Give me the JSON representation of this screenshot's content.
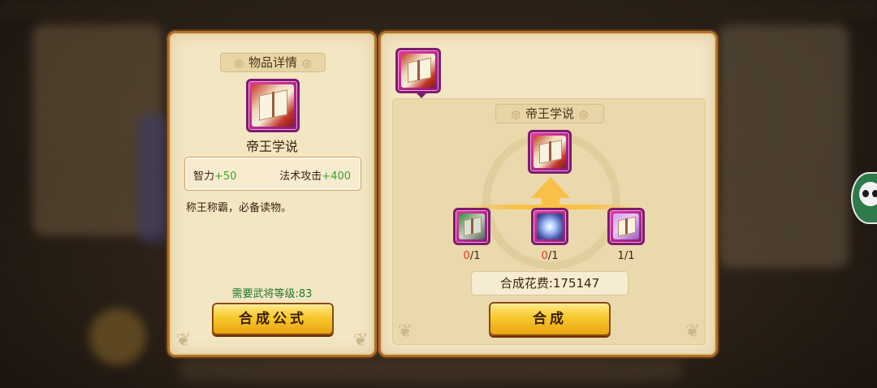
{
  "detail_panel": {
    "title": "物品详情",
    "item_name": "帝王学说",
    "stats": [
      {
        "label": "智力",
        "value": "+50"
      },
      {
        "label": "法术攻击",
        "value": "+400"
      }
    ],
    "description": "称王称霸，必备读物。",
    "level_requirement": "需要武将等级:83",
    "formula_button": "合成公式"
  },
  "synthesis_panel": {
    "target_title": "帝王学说",
    "materials": [
      {
        "icon": "green-chest-icon",
        "have": "0",
        "need": "/1"
      },
      {
        "icon": "silver-claw-icon",
        "have": "0",
        "need": "/1"
      },
      {
        "icon": "gold-book-icon",
        "have": "1",
        "need": "/1"
      }
    ],
    "cost_label": "合成花费:175147",
    "synthesize_button": "合成"
  },
  "colors": {
    "panel_bg": "#f3e6c3",
    "panel_border": "#b0712b",
    "button_gold": "#f8c92c",
    "level_text": "#1f7a2a",
    "stat_plus": "#3aa42a",
    "missing_count": "#e23a1a",
    "item_frame_purple": "#8a1a78"
  }
}
